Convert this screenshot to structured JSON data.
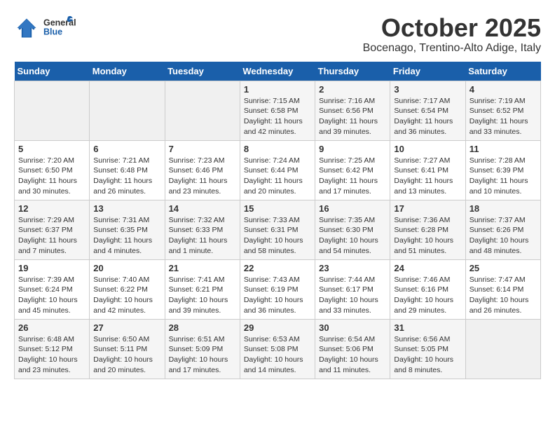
{
  "header": {
    "logo_line1": "General",
    "logo_line2": "Blue",
    "month": "October 2025",
    "location": "Bocenago, Trentino-Alto Adige, Italy"
  },
  "days_of_week": [
    "Sunday",
    "Monday",
    "Tuesday",
    "Wednesday",
    "Thursday",
    "Friday",
    "Saturday"
  ],
  "weeks": [
    [
      {
        "day": "",
        "info": ""
      },
      {
        "day": "",
        "info": ""
      },
      {
        "day": "",
        "info": ""
      },
      {
        "day": "1",
        "info": "Sunrise: 7:15 AM\nSunset: 6:58 PM\nDaylight: 11 hours and 42 minutes."
      },
      {
        "day": "2",
        "info": "Sunrise: 7:16 AM\nSunset: 6:56 PM\nDaylight: 11 hours and 39 minutes."
      },
      {
        "day": "3",
        "info": "Sunrise: 7:17 AM\nSunset: 6:54 PM\nDaylight: 11 hours and 36 minutes."
      },
      {
        "day": "4",
        "info": "Sunrise: 7:19 AM\nSunset: 6:52 PM\nDaylight: 11 hours and 33 minutes."
      }
    ],
    [
      {
        "day": "5",
        "info": "Sunrise: 7:20 AM\nSunset: 6:50 PM\nDaylight: 11 hours and 30 minutes."
      },
      {
        "day": "6",
        "info": "Sunrise: 7:21 AM\nSunset: 6:48 PM\nDaylight: 11 hours and 26 minutes."
      },
      {
        "day": "7",
        "info": "Sunrise: 7:23 AM\nSunset: 6:46 PM\nDaylight: 11 hours and 23 minutes."
      },
      {
        "day": "8",
        "info": "Sunrise: 7:24 AM\nSunset: 6:44 PM\nDaylight: 11 hours and 20 minutes."
      },
      {
        "day": "9",
        "info": "Sunrise: 7:25 AM\nSunset: 6:42 PM\nDaylight: 11 hours and 17 minutes."
      },
      {
        "day": "10",
        "info": "Sunrise: 7:27 AM\nSunset: 6:41 PM\nDaylight: 11 hours and 13 minutes."
      },
      {
        "day": "11",
        "info": "Sunrise: 7:28 AM\nSunset: 6:39 PM\nDaylight: 11 hours and 10 minutes."
      }
    ],
    [
      {
        "day": "12",
        "info": "Sunrise: 7:29 AM\nSunset: 6:37 PM\nDaylight: 11 hours and 7 minutes."
      },
      {
        "day": "13",
        "info": "Sunrise: 7:31 AM\nSunset: 6:35 PM\nDaylight: 11 hours and 4 minutes."
      },
      {
        "day": "14",
        "info": "Sunrise: 7:32 AM\nSunset: 6:33 PM\nDaylight: 11 hours and 1 minute."
      },
      {
        "day": "15",
        "info": "Sunrise: 7:33 AM\nSunset: 6:31 PM\nDaylight: 10 hours and 58 minutes."
      },
      {
        "day": "16",
        "info": "Sunrise: 7:35 AM\nSunset: 6:30 PM\nDaylight: 10 hours and 54 minutes."
      },
      {
        "day": "17",
        "info": "Sunrise: 7:36 AM\nSunset: 6:28 PM\nDaylight: 10 hours and 51 minutes."
      },
      {
        "day": "18",
        "info": "Sunrise: 7:37 AM\nSunset: 6:26 PM\nDaylight: 10 hours and 48 minutes."
      }
    ],
    [
      {
        "day": "19",
        "info": "Sunrise: 7:39 AM\nSunset: 6:24 PM\nDaylight: 10 hours and 45 minutes."
      },
      {
        "day": "20",
        "info": "Sunrise: 7:40 AM\nSunset: 6:22 PM\nDaylight: 10 hours and 42 minutes."
      },
      {
        "day": "21",
        "info": "Sunrise: 7:41 AM\nSunset: 6:21 PM\nDaylight: 10 hours and 39 minutes."
      },
      {
        "day": "22",
        "info": "Sunrise: 7:43 AM\nSunset: 6:19 PM\nDaylight: 10 hours and 36 minutes."
      },
      {
        "day": "23",
        "info": "Sunrise: 7:44 AM\nSunset: 6:17 PM\nDaylight: 10 hours and 33 minutes."
      },
      {
        "day": "24",
        "info": "Sunrise: 7:46 AM\nSunset: 6:16 PM\nDaylight: 10 hours and 29 minutes."
      },
      {
        "day": "25",
        "info": "Sunrise: 7:47 AM\nSunset: 6:14 PM\nDaylight: 10 hours and 26 minutes."
      }
    ],
    [
      {
        "day": "26",
        "info": "Sunrise: 6:48 AM\nSunset: 5:12 PM\nDaylight: 10 hours and 23 minutes."
      },
      {
        "day": "27",
        "info": "Sunrise: 6:50 AM\nSunset: 5:11 PM\nDaylight: 10 hours and 20 minutes."
      },
      {
        "day": "28",
        "info": "Sunrise: 6:51 AM\nSunset: 5:09 PM\nDaylight: 10 hours and 17 minutes."
      },
      {
        "day": "29",
        "info": "Sunrise: 6:53 AM\nSunset: 5:08 PM\nDaylight: 10 hours and 14 minutes."
      },
      {
        "day": "30",
        "info": "Sunrise: 6:54 AM\nSunset: 5:06 PM\nDaylight: 10 hours and 11 minutes."
      },
      {
        "day": "31",
        "info": "Sunrise: 6:56 AM\nSunset: 5:05 PM\nDaylight: 10 hours and 8 minutes."
      },
      {
        "day": "",
        "info": ""
      }
    ]
  ]
}
